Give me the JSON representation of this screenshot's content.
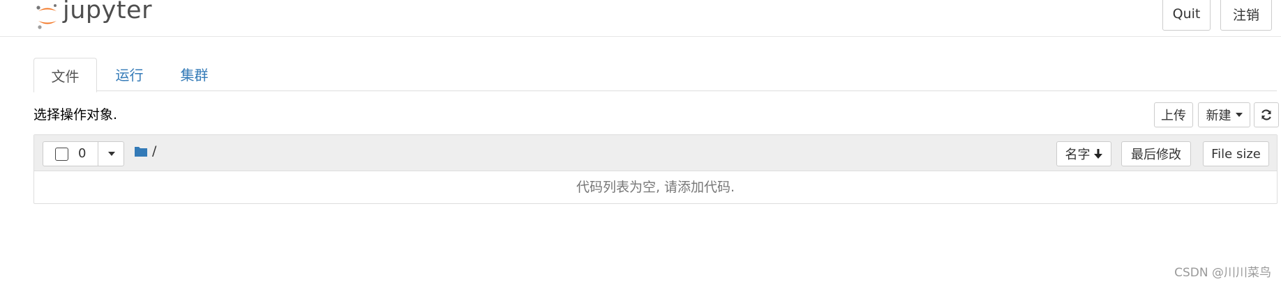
{
  "header": {
    "logo_text": "jupyter",
    "quit_label": "Quit",
    "logout_label": "注销"
  },
  "tabs": [
    {
      "label": "文件",
      "active": true
    },
    {
      "label": "运行",
      "active": false
    },
    {
      "label": "集群",
      "active": false
    }
  ],
  "toolbar": {
    "hint": "选择操作对象.",
    "upload_label": "上传",
    "new_label": "新建",
    "refresh_icon": "refresh-icon"
  },
  "file_list": {
    "selected_count": "0",
    "breadcrumb": "/",
    "columns": {
      "name": "名字",
      "last_modified": "最后修改",
      "file_size": "File size"
    },
    "empty_message": "代码列表为空, 请添加代码."
  },
  "watermark": "CSDN @川川菜鸟",
  "colors": {
    "link": "#337ab7",
    "logo_orange": "#f37726",
    "folder_blue": "#337ab7",
    "panel_header": "#eeeeee"
  }
}
